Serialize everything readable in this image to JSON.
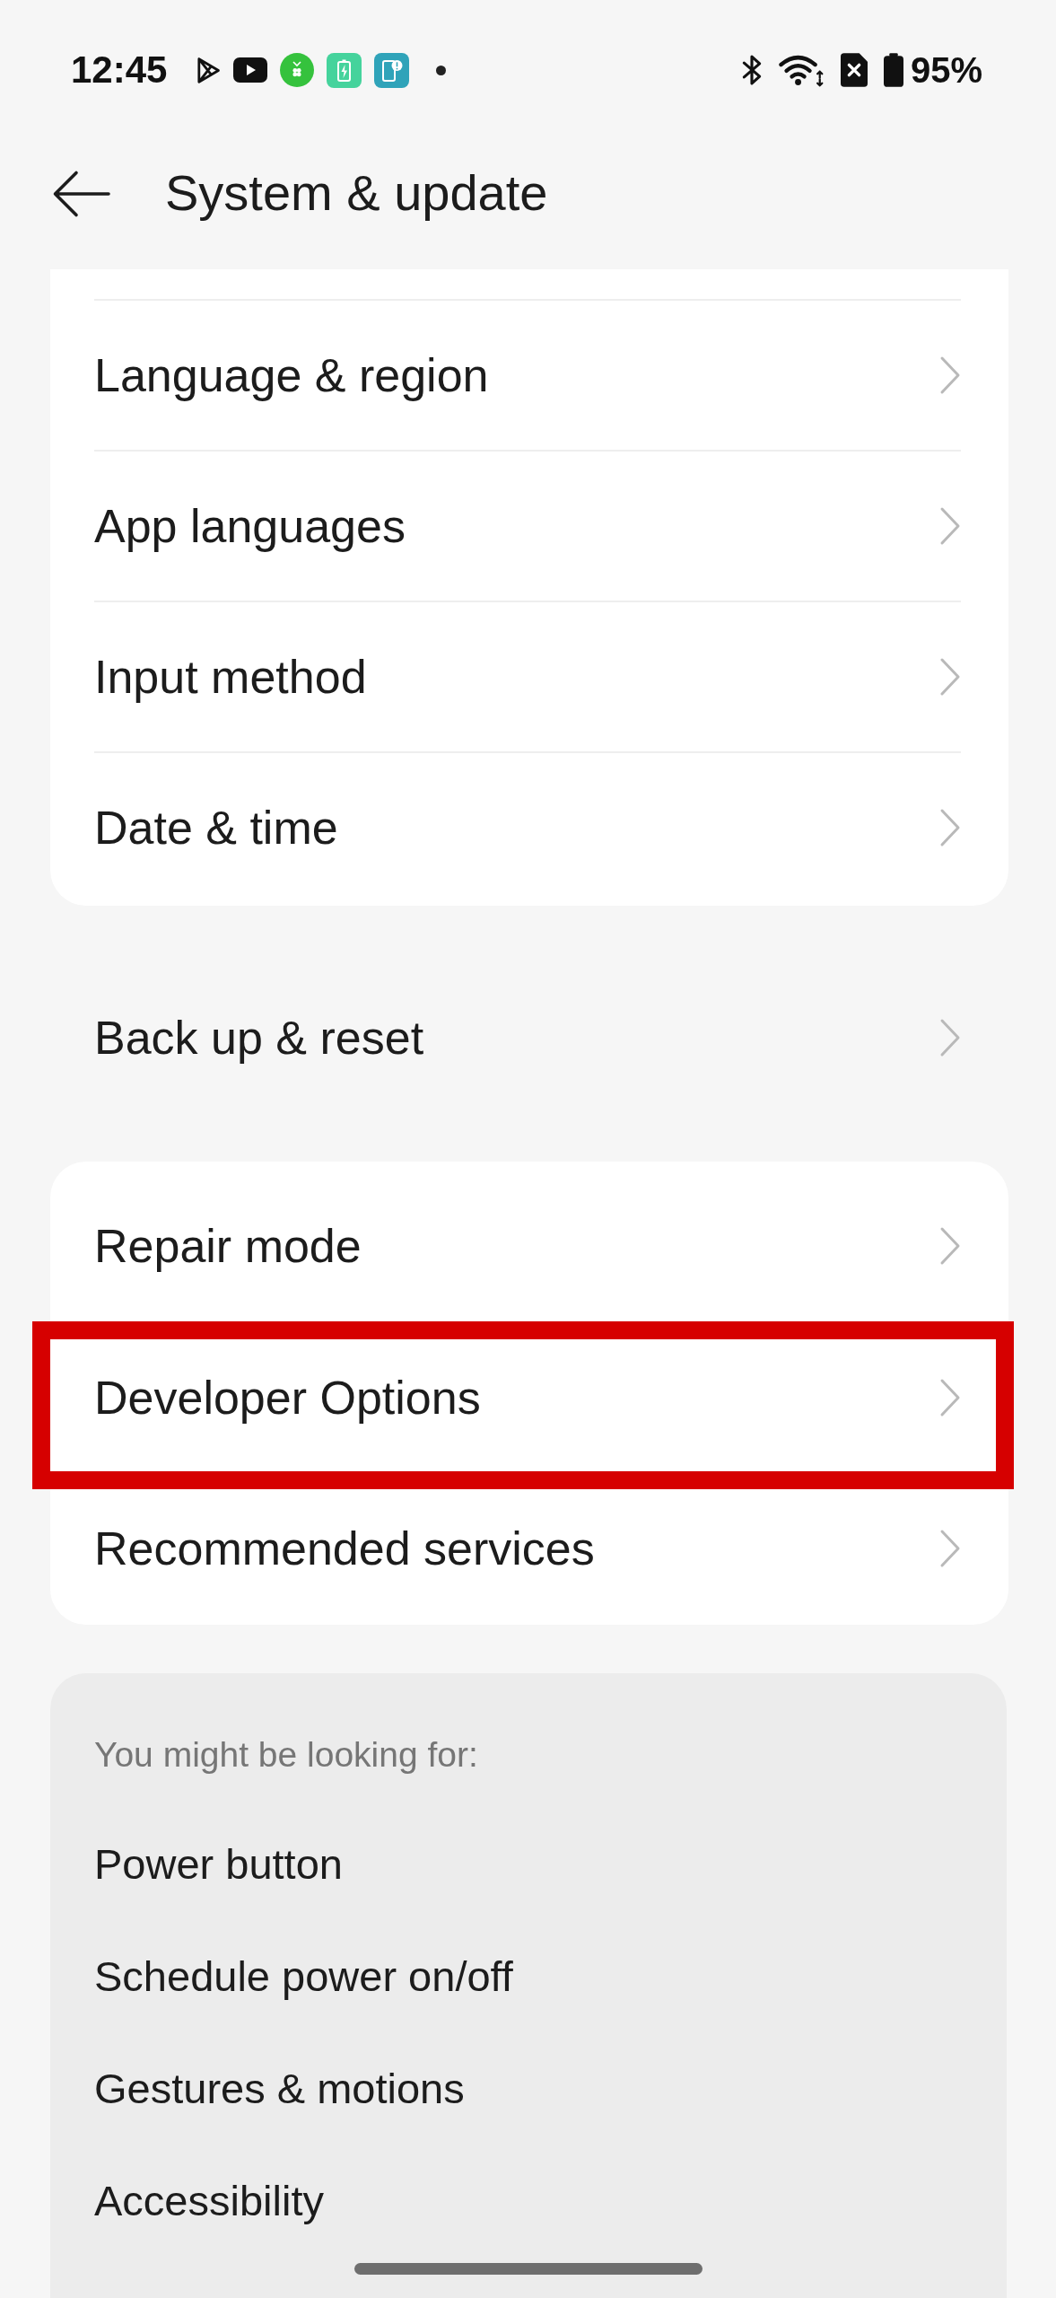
{
  "status_bar": {
    "time": "12:45",
    "battery_percent": "95%"
  },
  "header": {
    "title": "System & update"
  },
  "groups": [
    {
      "kind": "card",
      "items": [
        {
          "label": "Language & region",
          "highlighted": false
        },
        {
          "label": "App languages",
          "highlighted": false
        },
        {
          "label": "Input method",
          "highlighted": false
        },
        {
          "label": "Date & time",
          "highlighted": false
        }
      ]
    },
    {
      "kind": "plain",
      "items": [
        {
          "label": "Back up & reset",
          "highlighted": false
        }
      ]
    },
    {
      "kind": "card",
      "items": [
        {
          "label": "Repair mode",
          "highlighted": false
        },
        {
          "label": "Developer Options",
          "highlighted": true
        },
        {
          "label": "Recommended services",
          "highlighted": false
        }
      ]
    }
  ],
  "suggestions": {
    "heading": "You might be looking for:",
    "items": [
      "Power button",
      "Schedule power on/off",
      "Gestures & motions",
      "Accessibility"
    ]
  }
}
